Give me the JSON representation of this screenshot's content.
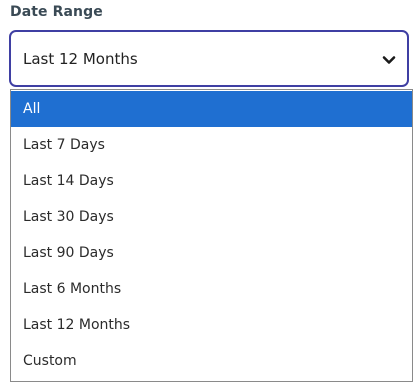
{
  "field": {
    "label": "Date Range",
    "selected_value": "Last 12 Months"
  },
  "icons": {
    "chevron": "chevron-down-icon"
  },
  "colors": {
    "focus_border": "#3f3fa3",
    "highlight": "#1f6fd1"
  },
  "options": [
    {
      "label": "All",
      "highlighted": true
    },
    {
      "label": "Last 7 Days",
      "highlighted": false
    },
    {
      "label": "Last 14 Days",
      "highlighted": false
    },
    {
      "label": "Last 30 Days",
      "highlighted": false
    },
    {
      "label": "Last 90 Days",
      "highlighted": false
    },
    {
      "label": "Last 6 Months",
      "highlighted": false
    },
    {
      "label": "Last 12 Months",
      "highlighted": false
    },
    {
      "label": "Custom",
      "highlighted": false
    }
  ]
}
